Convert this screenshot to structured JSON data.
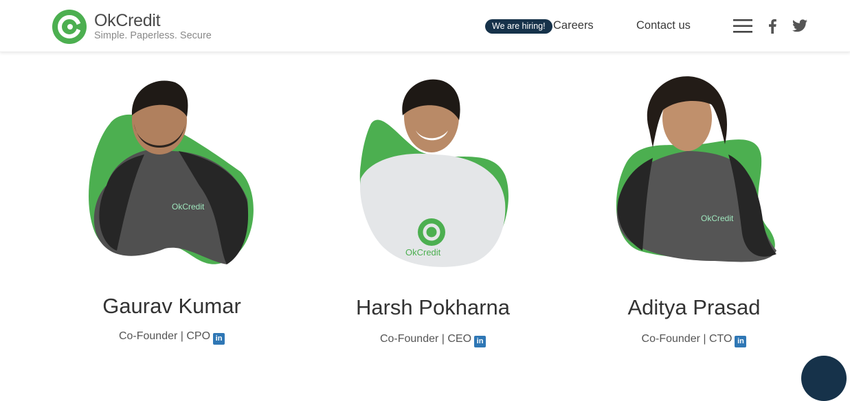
{
  "header": {
    "brand": "OkCredit",
    "tagline": "Simple. Paperless. Secure",
    "hiring_badge": "We are hiring!",
    "nav": {
      "careers": "Careers",
      "contact": "Contact us"
    },
    "icons": [
      "menu-icon",
      "facebook-icon",
      "twitter-icon"
    ]
  },
  "team": [
    {
      "name": "Gaurav Kumar",
      "role": "Co-Founder | CPO",
      "shirt_text": "OkCredit"
    },
    {
      "name": "Harsh Pokharna",
      "role": "Co-Founder | CEO",
      "shirt_text": "OkCredit"
    },
    {
      "name": "Aditya Prasad",
      "role": "Co-Founder | CTO",
      "shirt_text": "OkCredit"
    }
  ],
  "colors": {
    "brand_green": "#4caf50",
    "navy": "#16324a",
    "linkedin": "#2f77b5"
  }
}
